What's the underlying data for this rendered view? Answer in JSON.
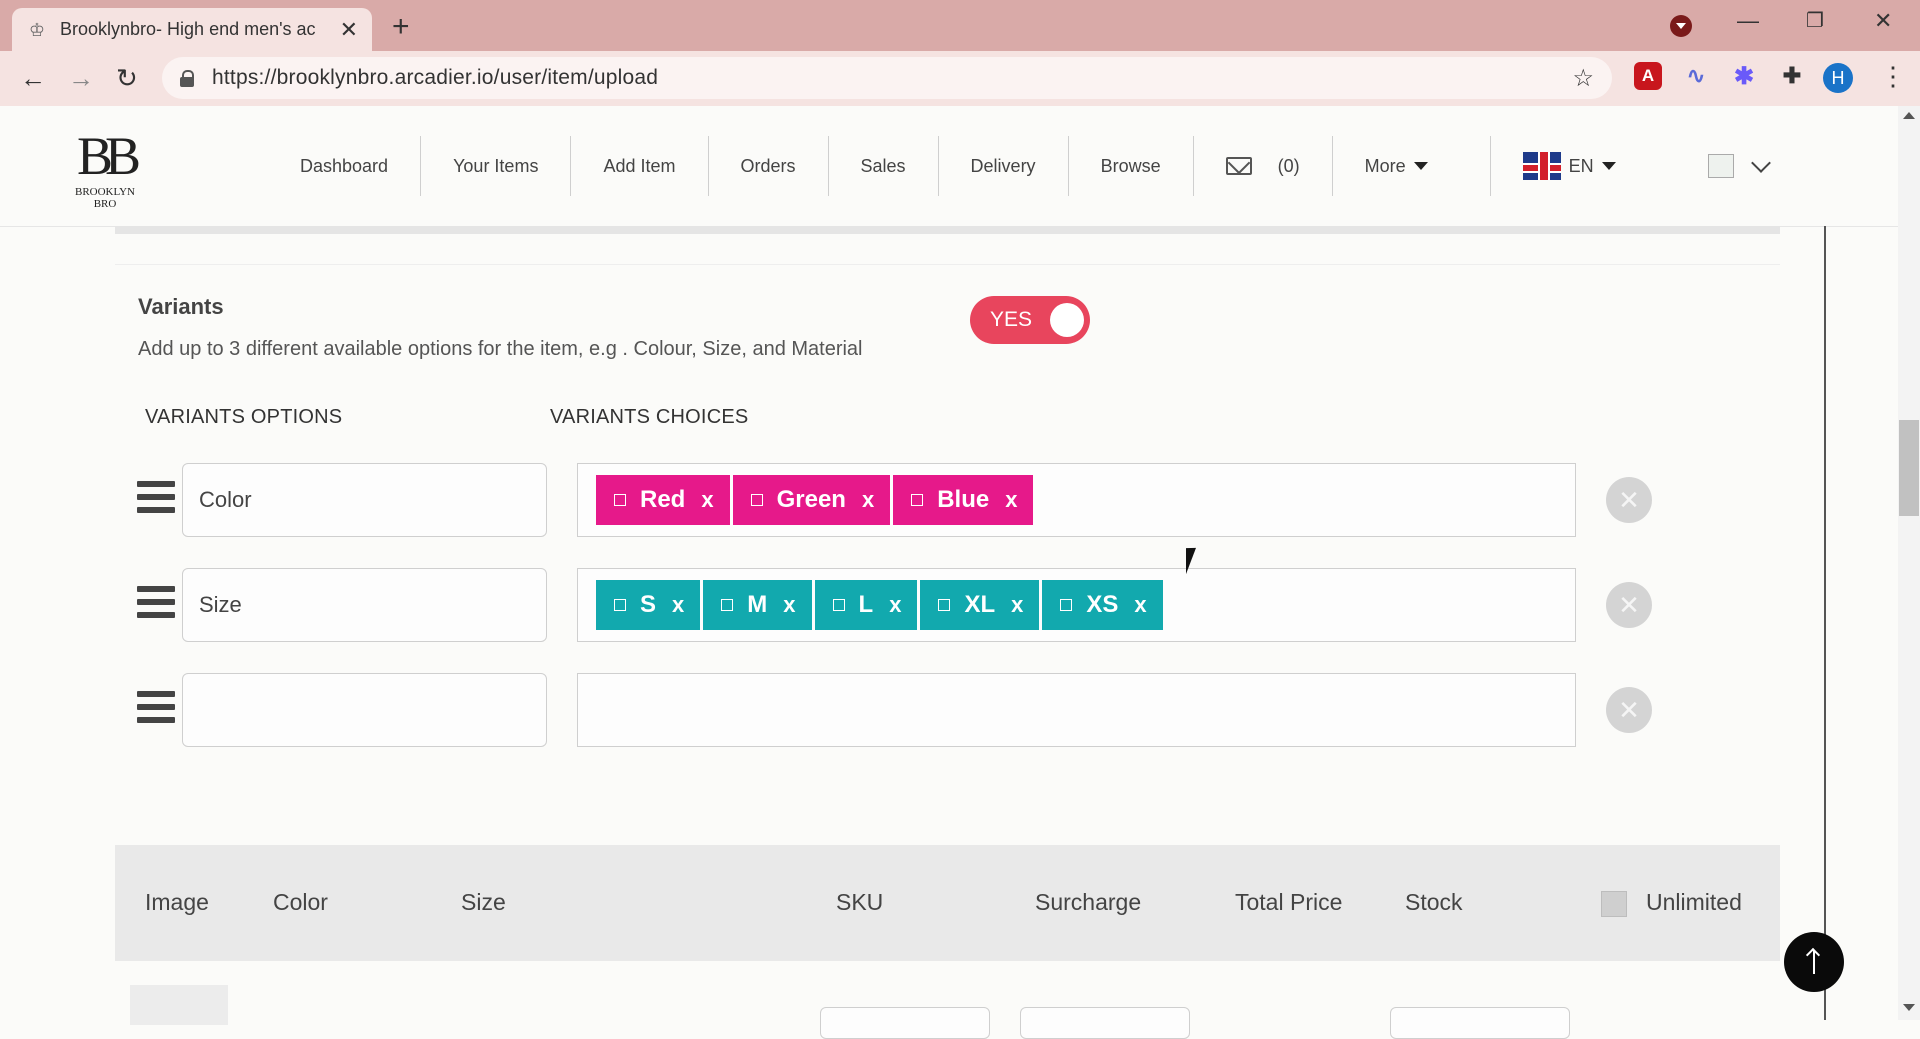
{
  "browser": {
    "tab_title": "Brooklynbro- High end men's ac",
    "url": "https://brooklynbro.arcadier.io/user/item/upload",
    "profile_initial": "H"
  },
  "header": {
    "logo_monogram": "BB",
    "logo_text": "BROOKLYN BRO",
    "nav": [
      "Dashboard",
      "Your Items",
      "Add Item",
      "Orders",
      "Sales",
      "Delivery",
      "Browse"
    ],
    "messages_count": "(0)",
    "more_label": "More",
    "language": "EN"
  },
  "variants": {
    "title": "Variants",
    "description": "Add up to 3 different available options for the item, e.g . Colour, Size, and Material",
    "toggle_label": "YES",
    "options_heading": "VARIANTS OPTIONS",
    "choices_heading": "VARIANTS CHOICES",
    "rows": [
      {
        "option": "Color",
        "choices": [
          "Red",
          "Green",
          "Blue"
        ],
        "chip_color": "#e6198a"
      },
      {
        "option": "Size",
        "choices": [
          "S",
          "M",
          "L",
          "XL",
          "XS"
        ],
        "chip_color": "#12a9ae"
      },
      {
        "option": "",
        "choices": []
      }
    ],
    "chip_remove": "x"
  },
  "table": {
    "columns": [
      "Image",
      "Color",
      "Size",
      "SKU",
      "Surcharge",
      "Total Price",
      "Stock",
      "Unlimited"
    ]
  },
  "colors": {
    "toggle_on": "#e8455d",
    "chrome_tabbar": "#d9aaa8",
    "chrome_toolbar": "#f5e3e1"
  }
}
